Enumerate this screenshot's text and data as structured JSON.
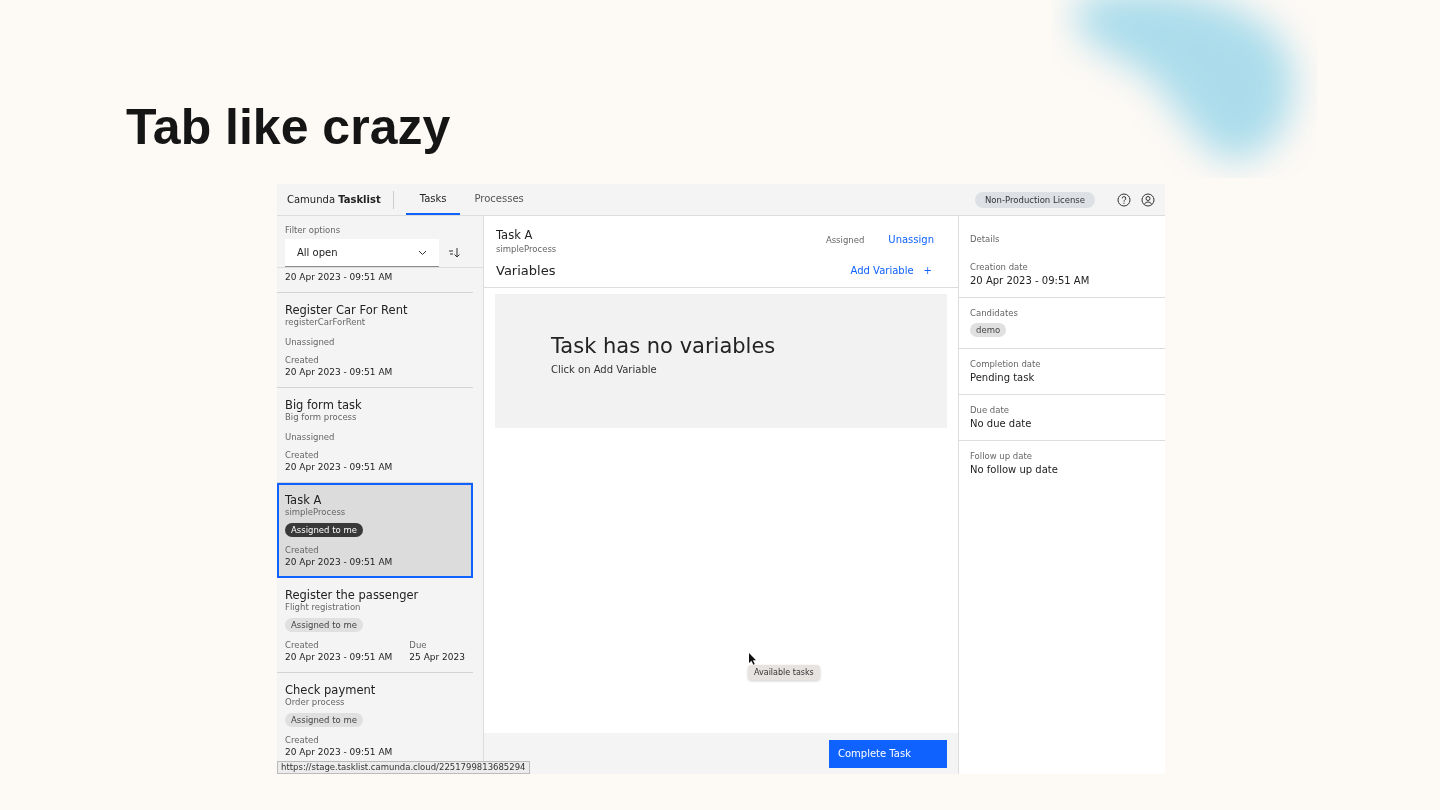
{
  "slide": {
    "title": "Tab like crazy"
  },
  "header": {
    "brand": "Camunda **Tasklist**",
    "tabs": [
      {
        "label": "Tasks",
        "selected": true
      },
      {
        "label": "Processes",
        "selected": false
      }
    ],
    "license": "Non-Production License"
  },
  "filter": {
    "label": "Filter options",
    "value": "All open"
  },
  "tasks": [
    {
      "created_value": "20 Apr 2023 - 09:51 AM",
      "selected": false
    },
    {
      "name": "Register Car For Rent",
      "process": "registerCarForRent",
      "assignee": "Unassigned",
      "assigned": false,
      "created_label": "Created",
      "created_value": "20 Apr 2023 - 09:51 AM",
      "selected": false
    },
    {
      "name": "Big form task",
      "process": "Big form process",
      "assignee": "Unassigned",
      "assigned": false,
      "created_label": "Created",
      "created_value": "20 Apr 2023 - 09:51 AM",
      "selected": false
    },
    {
      "name": "Task A",
      "process": "simpleProcess",
      "assignee": "Assigned to me",
      "assigned": true,
      "created_label": "Created",
      "created_value": "20 Apr 2023 - 09:51 AM",
      "selected": true
    },
    {
      "name": "Register the passenger",
      "process": "Flight registration",
      "assignee": "Assigned to me",
      "assigned": true,
      "created_label": "Created",
      "created_value": "20 Apr 2023 - 09:51 AM",
      "due_label": "Due",
      "due_value": "25 Apr 2023",
      "selected": false
    },
    {
      "name": "Check payment",
      "process": "Order process",
      "assignee": "Assigned to me",
      "assigned": true,
      "created_label": "Created",
      "created_value": "20 Apr 2023 - 09:51 AM",
      "selected": false
    }
  ],
  "status_url": "https://stage.tasklist.camunda.cloud/2251799813685294",
  "task": {
    "name": "Task A",
    "process": "simpleProcess",
    "state": "Assigned",
    "action": "Unassign"
  },
  "variables": {
    "heading": "Variables",
    "add": "Add Variable",
    "add_symbol": "+",
    "empty_title": "Task has no variables",
    "empty_hint": "Click on Add Variable"
  },
  "tooltip": "Available tasks",
  "complete_button": "Complete Task",
  "details": {
    "heading": "Details",
    "sections": [
      {
        "label": "Creation date",
        "value": "20 Apr 2023 - 09:51 AM",
        "kind": "text"
      },
      {
        "label": "Candidates",
        "value": "demo",
        "kind": "tag"
      },
      {
        "label": "Completion date",
        "value": "Pending task",
        "kind": "text"
      },
      {
        "label": "Due date",
        "value": "No due date",
        "kind": "text"
      },
      {
        "label": "Follow up date",
        "value": "No follow up date",
        "kind": "text"
      }
    ]
  }
}
